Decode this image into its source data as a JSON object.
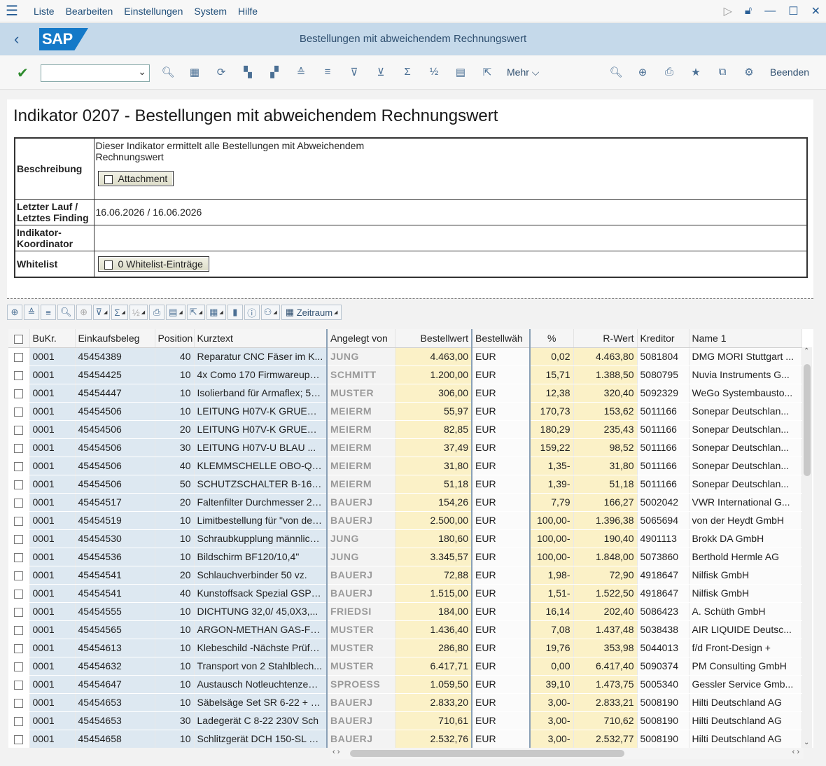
{
  "menu": [
    "Liste",
    "Bearbeiten",
    "Einstellungen",
    "System",
    "Hilfe"
  ],
  "title": "Bestellungen mit abweichendem Rechnungswert",
  "logo_text": "SAP",
  "toolbar": {
    "more": "Mehr",
    "exit": "Beenden"
  },
  "header": {
    "heading": "Indikator 0207 - Bestellungen mit abweichendem Rechnungswert"
  },
  "info": {
    "desc_label": "Beschreibung",
    "desc_text_1": "Dieser Indikator ermittelt alle Bestellungen mit Abweichendem",
    "desc_text_2": "Rechnungswert",
    "attachment_btn": "Attachment",
    "lastrun_label_1": "Letzter Lauf /",
    "lastrun_label_2": "Letztes Finding",
    "lastrun_value": "16.06.2026 / 16.06.2026",
    "coord_label_1": "Indikator-",
    "coord_label_2": "Koordinator",
    "whitelist_label": "Whitelist",
    "whitelist_btn": "0 Whitelist-Einträge"
  },
  "alv": {
    "period_btn": "Zeitraum"
  },
  "columns": [
    "BuKr.",
    "Einkaufsbeleg",
    "Position",
    "Kurztext",
    "Angelegt von",
    "Bestellwert",
    "Bestellwäh",
    "%",
    "R-Wert",
    "Kreditor",
    "Name 1"
  ],
  "rows": [
    [
      "0001",
      "45454389",
      "40",
      "Reparatur CNC Fäser im K...",
      "JUNG",
      "4.463,00",
      "EUR",
      "0,02",
      "4.463,80",
      "5081804",
      "DMG MORI Stuttgart ..."
    ],
    [
      "0001",
      "45454425",
      "10",
      "4x Como 170 Firmwareupd...",
      "SCHMITT",
      "1.200,00",
      "EUR",
      "15,71",
      "1.388,50",
      "5080795",
      "Nuvia Instruments G..."
    ],
    [
      "0001",
      "45454447",
      "10",
      "Isolierband für Armaflex; 50...",
      "MUSTER",
      "306,00",
      "EUR",
      "12,38",
      "320,40",
      "5092329",
      "WeGo Systembausto..."
    ],
    [
      "0001",
      "45454506",
      "10",
      "LEITUNG H07V-K   GRUEN/...",
      "MEIERM",
      "55,97",
      "EUR",
      "170,73",
      "153,62",
      "5011166",
      "Sonepar Deutschlan..."
    ],
    [
      "0001",
      "45454506",
      "20",
      "LEITUNG H07V-K   GRUEN/...",
      "MEIERM",
      "82,85",
      "EUR",
      "180,29",
      "235,43",
      "5011166",
      "Sonepar Deutschlan..."
    ],
    [
      "0001",
      "45454506",
      "30",
      "LEITUNG H07V-U   BLAU    ...",
      "MEIERM",
      "37,49",
      "EUR",
      "159,22",
      "98,52",
      "5011166",
      "Sonepar Deutschlan..."
    ],
    [
      "0001",
      "45454506",
      "40",
      "KLEMMSCHELLE OBO-QUI...",
      "MEIERM",
      "31,80",
      "EUR",
      "1,35-",
      "31,80",
      "5011166",
      "Sonepar Deutschlan..."
    ],
    [
      "0001",
      "45454506",
      "50",
      "SCHUTZSCHALTER B-16,0...",
      "MEIERM",
      "51,18",
      "EUR",
      "1,39-",
      "51,18",
      "5011166",
      "Sonepar Deutschlan..."
    ],
    [
      "0001",
      "45454517",
      "20",
      "Faltenfilter Durchmesser 27...",
      "BAUERJ",
      "154,26",
      "EUR",
      "7,79",
      "166,27",
      "5002042",
      "VWR International G..."
    ],
    [
      "0001",
      "45454519",
      "10",
      "Limitbestellung für \"von der ...",
      "BAUERJ",
      "2.500,00",
      "EUR",
      "100,00-",
      "1.396,38",
      "5065694",
      "von der Heydt GmbH"
    ],
    [
      "0001",
      "45454530",
      "10",
      "Schraubkupplung männlich ...",
      "JUNG",
      "180,60",
      "EUR",
      "100,00-",
      "190,40",
      "4901113",
      "Brokk DA GmbH"
    ],
    [
      "0001",
      "45454536",
      "10",
      "Bildschirm BF120/10,4\"",
      "JUNG",
      "3.345,57",
      "EUR",
      "100,00-",
      "1.848,00",
      "5073860",
      "Berthold Hermle AG"
    ],
    [
      "0001",
      "45454541",
      "20",
      "Schlauchverbinder 50 vz.",
      "BAUERJ",
      "72,88",
      "EUR",
      "1,98-",
      "72,90",
      "4918647",
      "Nilfisk GmbH"
    ],
    [
      "0001",
      "45454541",
      "40",
      "Kunstoffsack Spezial GSP8...",
      "BAUERJ",
      "1.515,00",
      "EUR",
      "1,51-",
      "1.522,50",
      "4918647",
      "Nilfisk GmbH"
    ],
    [
      "0001",
      "45454555",
      "10",
      "DICHTUNG   32,0/  45,0X3,...",
      "FRIEDSI",
      "184,00",
      "EUR",
      "16,14",
      "202,40",
      "5086423",
      "A. Schüth GmbH"
    ],
    [
      "0001",
      "45454565",
      "10",
      "ARGON-METHAN GAS-FLA...",
      "MUSTER",
      "1.436,40",
      "EUR",
      "7,08",
      "1.437,48",
      "5038438",
      "AIR LIQUIDE Deutsc..."
    ],
    [
      "0001",
      "45454613",
      "10",
      "Klebeschild -Nächste Prüfu...",
      "MUSTER",
      "286,80",
      "EUR",
      "19,76",
      "353,98",
      "5044013",
      "f/d Front-Design +"
    ],
    [
      "0001",
      "45454632",
      "10",
      "Transport von 2 Stahlblech...",
      "MUSTER",
      "6.417,71",
      "EUR",
      "0,00",
      "6.417,40",
      "5090374",
      "PM Consulting GmbH"
    ],
    [
      "0001",
      "45454647",
      "10",
      "Austausch Notleuchtenzentr...",
      "SPROESS",
      "1.059,50",
      "EUR",
      "39,10",
      "1.473,75",
      "5005340",
      "Gessler Service Gmb..."
    ],
    [
      "0001",
      "45454653",
      "10",
      "Säbelsäge Set SR 6-22 + S...",
      "BAUERJ",
      "2.833,20",
      "EUR",
      "3,00-",
      "2.833,21",
      "5008190",
      "Hilti Deutschland AG"
    ],
    [
      "0001",
      "45454653",
      "30",
      "Ladegerät C 8-22 230V Sch",
      "BAUERJ",
      "710,61",
      "EUR",
      "3,00-",
      "710,62",
      "5008190",
      "Hilti Deutschland AG"
    ],
    [
      "0001",
      "45454658",
      "10",
      "Schlitzgerät DCH 150-SL 23...",
      "BAUERJ",
      "2.532,76",
      "EUR",
      "3,00-",
      "2.532,77",
      "5008190",
      "Hilti Deutschland AG"
    ]
  ]
}
